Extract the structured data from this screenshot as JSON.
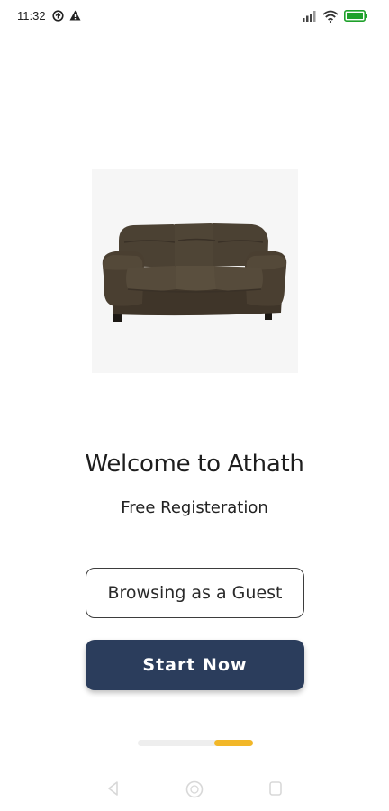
{
  "status_bar": {
    "time": "11:32",
    "icons": [
      "data-saver-icon",
      "alert-triangle-icon",
      "signal-icon",
      "wifi-icon",
      "battery-icon"
    ],
    "battery_color": "#1fa12b"
  },
  "hero": {
    "image": "sofa-image"
  },
  "welcome": {
    "title": "Welcome to Athath",
    "subtitle": "Free Registeration"
  },
  "actions": {
    "guest_label": "Browsing as a Guest",
    "start_label": "Start Now"
  },
  "pager": {
    "pages": 3,
    "current": 3
  },
  "nav_bar": {
    "icons": [
      "back-icon",
      "home-icon",
      "recents-icon"
    ]
  },
  "colors": {
    "primary": "#2b3d5c",
    "accent": "#f2b728",
    "background": "#ffffff"
  }
}
